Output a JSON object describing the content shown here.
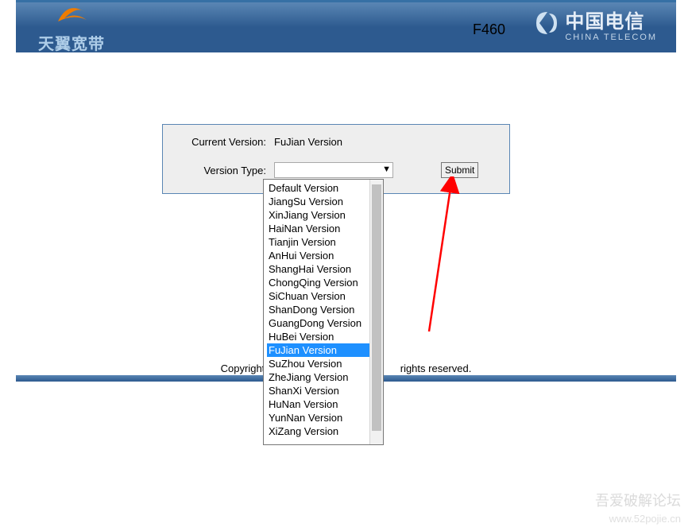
{
  "header": {
    "left_brand_cn": "天翼宽带",
    "device_model": "F460",
    "ct_cn": "中国电信",
    "ct_en": "CHINA TELECOM"
  },
  "panel": {
    "current_version_label": "Current Version:",
    "current_version_value": "FuJian Version",
    "version_type_label": "Version Type:",
    "selected_value": "",
    "submit_label": "Submit"
  },
  "dropdown": {
    "highlighted_index": 12,
    "options": [
      "Default Version",
      "JiangSu Version",
      "XinJiang Version",
      "HaiNan Version",
      "Tianjin Version",
      "AnHui Version",
      "ShangHai Version",
      "ChongQing Version",
      "SiChuan Version",
      "ShanDong Version",
      "GuangDong Version",
      "HuBei Version",
      "FuJian Version",
      "SuZhou Version",
      "ZheJiang Version",
      "ShanXi Version",
      "HuNan Version",
      "YunNan Version",
      "XiZang Version"
    ]
  },
  "footer": {
    "copyright_left": "Copyright © ",
    "copyright_right": " rights reserved."
  },
  "watermark": {
    "line1": "吾爱破解论坛",
    "line2": "www.52pojie.cn"
  },
  "colors": {
    "header_gradient_top": "#5a86b4",
    "header_gradient_bottom": "#2d5a8f",
    "panel_bg": "#eeeeee",
    "panel_border": "#5a86b4",
    "highlight": "#1e90ff",
    "arrow": "#ff0000"
  }
}
